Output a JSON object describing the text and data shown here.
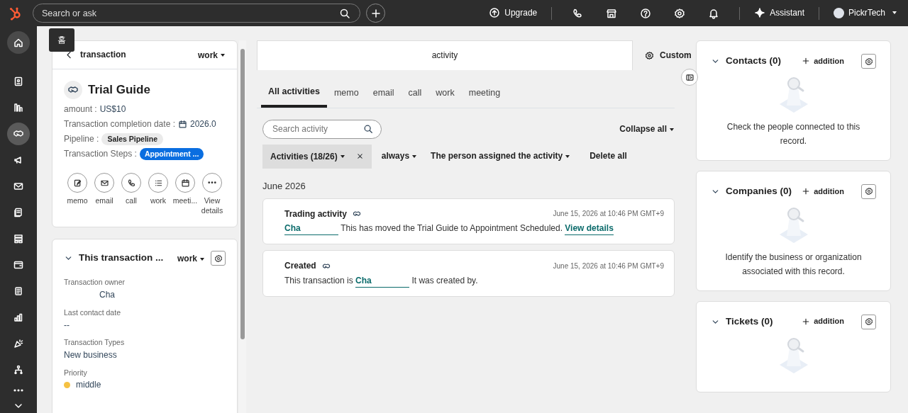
{
  "topbar": {
    "search": {
      "placeholder": "Search or ask"
    },
    "upgrade": "Upgrade",
    "assistant": "Assistant",
    "account": "PickrTech"
  },
  "sidebar": {
    "items": [
      {
        "selected": false,
        "tooltip": "홈"
      },
      {
        "selected": false
      },
      {
        "selected": false
      },
      {
        "selected": true
      },
      {
        "selected": false
      },
      {
        "selected": false
      },
      {
        "selected": false
      },
      {
        "selected": false
      },
      {
        "selected": false
      },
      {
        "selected": false
      },
      {
        "selected": false
      },
      {
        "selected": false
      },
      {
        "selected": false
      }
    ]
  },
  "record": {
    "back_label": "transaction",
    "menu": "work",
    "title": "Trial Guide",
    "fields": [
      {
        "kind": "text",
        "label": "amount :",
        "value": "US$10"
      },
      {
        "kind": "date",
        "label": "Transaction completion date :",
        "value": "2026.0"
      },
      {
        "kind": "tag",
        "label": "Pipeline :",
        "value": "Sales Pipeline"
      },
      {
        "kind": "stage",
        "label": "Transaction Steps :",
        "value": "Appointment ..."
      }
    ],
    "actions": [
      "memo",
      "email",
      "call",
      "work",
      "meeti...",
      "View details"
    ]
  },
  "about": {
    "title": "This transaction ...",
    "menu": "work",
    "properties": [
      {
        "kind": "user",
        "label": "Transaction owner",
        "value": "Cha"
      },
      {
        "kind": "text",
        "label": "Last contact date",
        "value": "--"
      },
      {
        "kind": "text",
        "label": "Transaction Types",
        "value": "New business"
      },
      {
        "kind": "status",
        "label": "Priority",
        "value": "middle",
        "color": "#f5c142"
      }
    ]
  },
  "middle": {
    "header_tab": {
      "label": "activity",
      "selected": true
    },
    "custom": "Custom",
    "tabs": [
      {
        "label": "All activities",
        "selected": true
      },
      {
        "label": "memo",
        "selected": false
      },
      {
        "label": "email",
        "selected": false
      },
      {
        "label": "call",
        "selected": false
      },
      {
        "label": "work",
        "selected": false
      },
      {
        "label": "meeting",
        "selected": false
      }
    ],
    "search": {
      "placeholder": "Search activity"
    },
    "collapse": "Collapse all",
    "filters": [
      {
        "kind": "chip",
        "label": "Activities (18/26)"
      },
      {
        "kind": "dropdown",
        "label": "always"
      },
      {
        "kind": "dropdown",
        "label": "The person assigned the activity"
      },
      {
        "kind": "action",
        "label": "Delete all"
      }
    ],
    "month": "June 2026",
    "activities": [
      {
        "title": "Trading activity",
        "time": "June 15, 2026 at 10:46 PM GMT+9",
        "body": [
          {
            "kind": "link",
            "text": "Cha"
          },
          {
            "kind": "text",
            "text": "This has moved the Trial Guide to Appointment Scheduled."
          },
          {
            "kind": "link",
            "text": "View details"
          }
        ]
      },
      {
        "title": "Created",
        "time": "June 15, 2026 at 10:46 PM GMT+9",
        "body": [
          {
            "kind": "text",
            "text": "This transaction is"
          },
          {
            "kind": "link",
            "text": "Cha"
          },
          {
            "kind": "text",
            "text": "It was created by."
          }
        ]
      }
    ]
  },
  "associations": [
    {
      "title": "Contacts (0)",
      "add": "addition",
      "description": "Check the people connected to this record."
    },
    {
      "title": "Companies (0)",
      "add": "addition",
      "description": "Identify the business or organization associated with this record."
    },
    {
      "title": "Tickets (0)",
      "add": "addition"
    }
  ]
}
